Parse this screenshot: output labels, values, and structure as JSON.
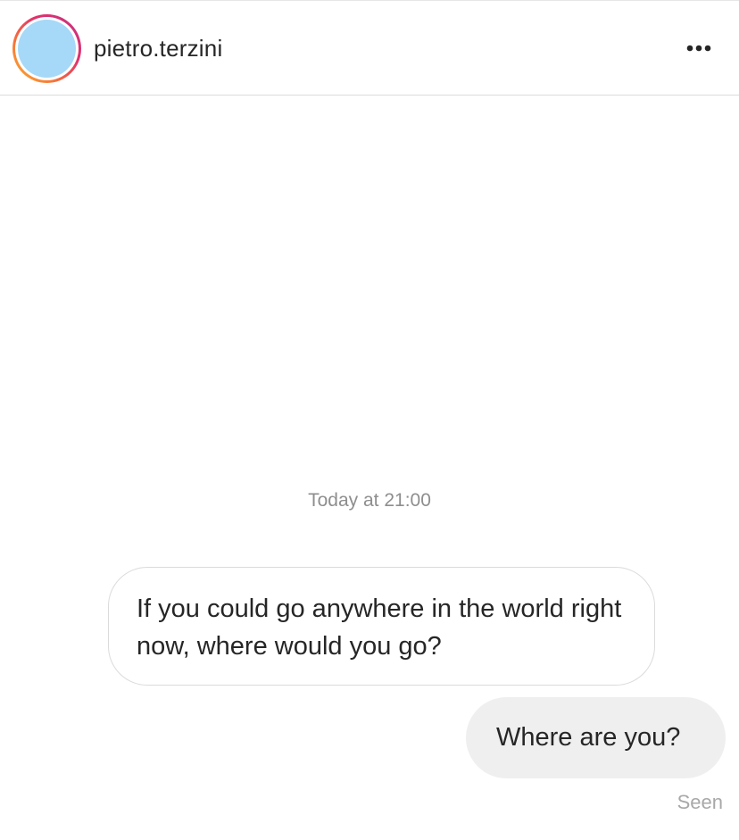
{
  "header": {
    "username": "pietro.terzini",
    "avatar_color": "#a6d8f8",
    "story_ring_colors": [
      "#f9b233",
      "#f77737",
      "#e1306c",
      "#c13584"
    ],
    "more_icon": "more-horizontal-icon"
  },
  "conversation": {
    "timestamp": "Today at 21:00",
    "messages": [
      {
        "direction": "received",
        "text": "If you could go anywhere in the world right now, where would you go?"
      },
      {
        "direction": "sent",
        "text": "Where are you?"
      }
    ],
    "status": "Seen"
  }
}
